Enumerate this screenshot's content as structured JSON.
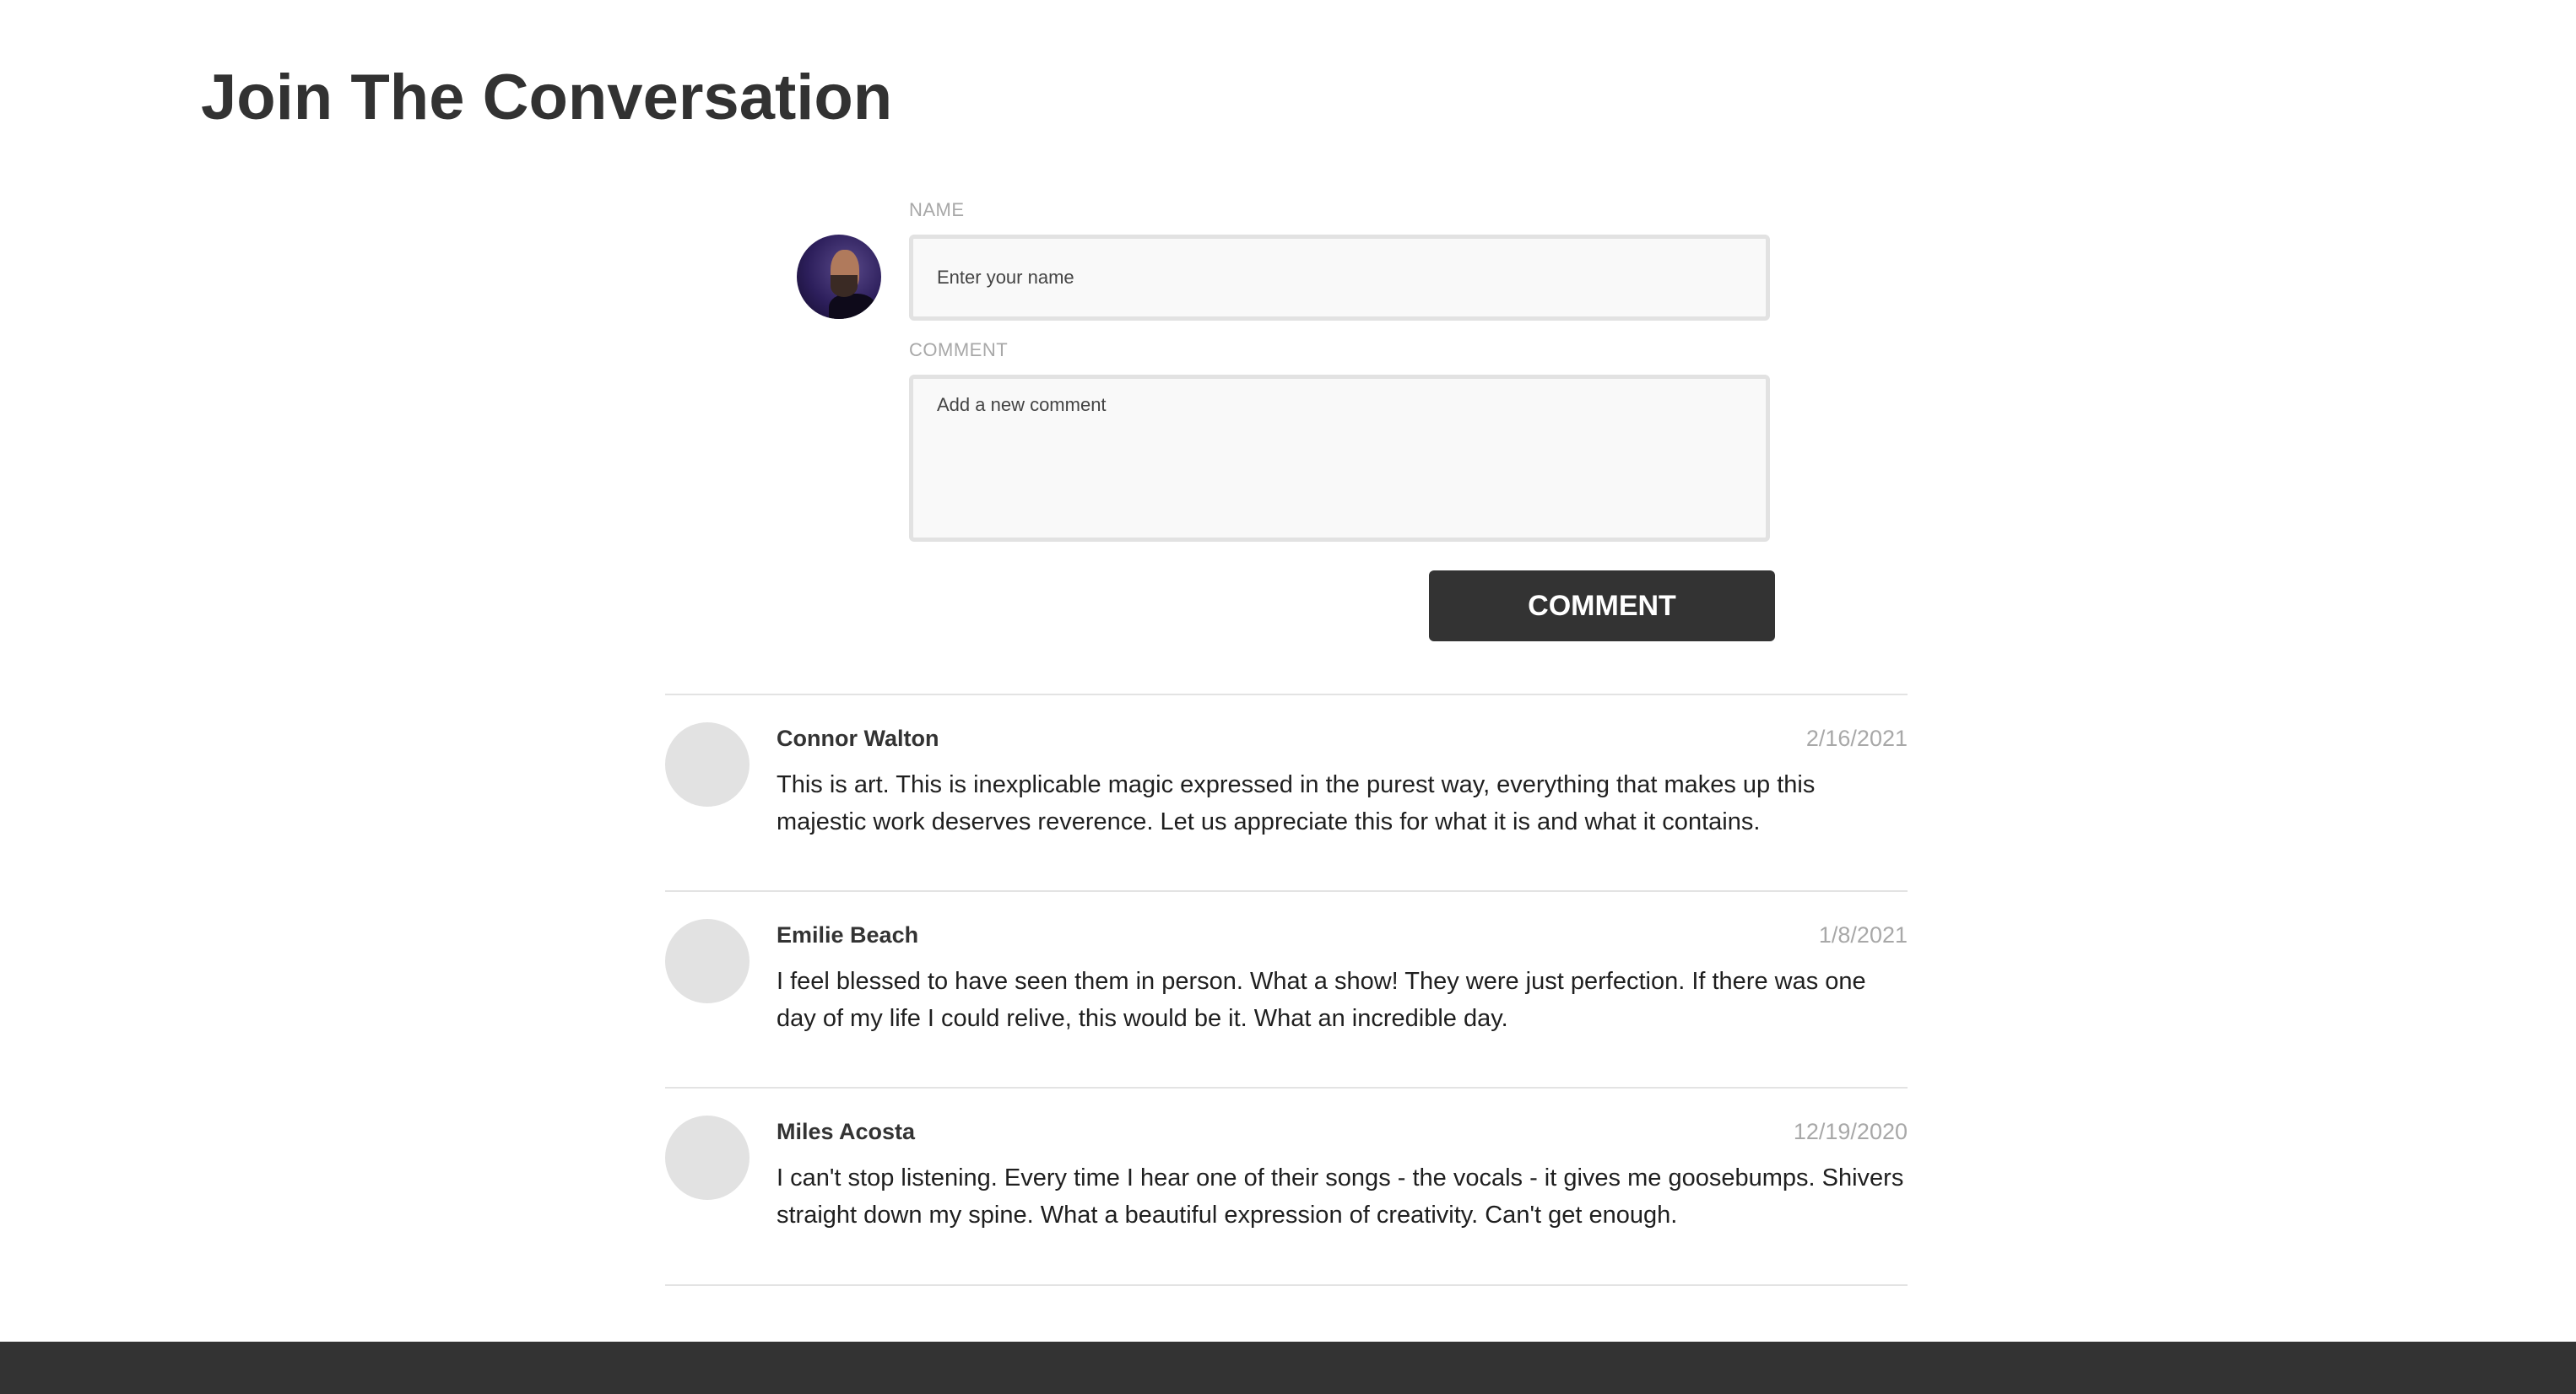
{
  "page": {
    "title": "Join The Conversation"
  },
  "form": {
    "name_label": "NAME",
    "name_placeholder": "Enter your name",
    "name_value": "",
    "comment_label": "COMMENT",
    "comment_placeholder": "Add a new comment",
    "comment_value": "",
    "submit_label": "COMMENT"
  },
  "comments": [
    {
      "author": "Connor Walton",
      "date": "2/16/2021",
      "text": "This is art. This is inexplicable magic expressed in the purest way, everything that makes up this majestic work deserves reverence. Let us appreciate this for what it is and what it contains."
    },
    {
      "author": "Emilie Beach",
      "date": "1/8/2021",
      "text": "I feel blessed to have seen them in person. What a show! They were just perfection. If there was one day of my life I could relive, this would be it. What an incredible day."
    },
    {
      "author": "Miles Acosta",
      "date": "12/19/2020",
      "text": "I can't stop listening. Every time I hear one of their songs - the vocals - it gives me goosebumps. Shivers straight down my spine. What a beautiful expression of creativity. Can't get enough."
    }
  ],
  "colors": {
    "button_bg": "#333333",
    "footer_bg": "#333333",
    "label_gray": "#a8a8a8",
    "divider": "#e3e3e3",
    "avatar_placeholder": "#e2e2e2"
  }
}
